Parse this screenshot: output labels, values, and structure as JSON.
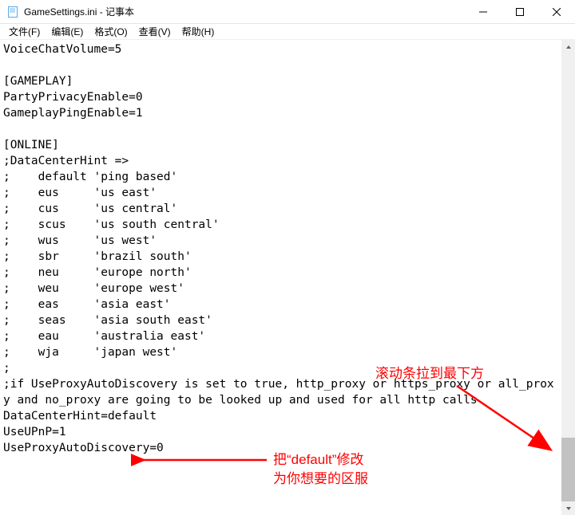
{
  "window": {
    "title": "GameSettings.ini - 记事本"
  },
  "menus": {
    "file": "文件(F)",
    "edit": "编辑(E)",
    "format": "格式(O)",
    "view": "查看(V)",
    "help": "帮助(H)"
  },
  "editor_text": "VoiceChatVolume=5\n\n[GAMEPLAY]\nPartyPrivacyEnable=0\nGameplayPingEnable=1\n\n[ONLINE]\n;DataCenterHint =>\n;    default 'ping based'\n;    eus     'us east'\n;    cus     'us central'\n;    scus    'us south central'\n;    wus     'us west'\n;    sbr     'brazil south'\n;    neu     'europe north'\n;    weu     'europe west'\n;    eas     'asia east'\n;    seas    'asia south east'\n;    eau     'australia east'\n;    wja     'japan west'\n;\n;if UseProxyAutoDiscovery is set to true, http_proxy or https_proxy or all_proxy and no_proxy are going to be looked up and used for all http calls\nDataCenterHint=default\nUseUPnP=1\nUseProxyAutoDiscovery=0",
  "annotations": {
    "scroll_hint": "滚动条拉到最下方",
    "modify_hint_l1": "把“default”修改",
    "modify_hint_l2": "为你想要的区服"
  }
}
